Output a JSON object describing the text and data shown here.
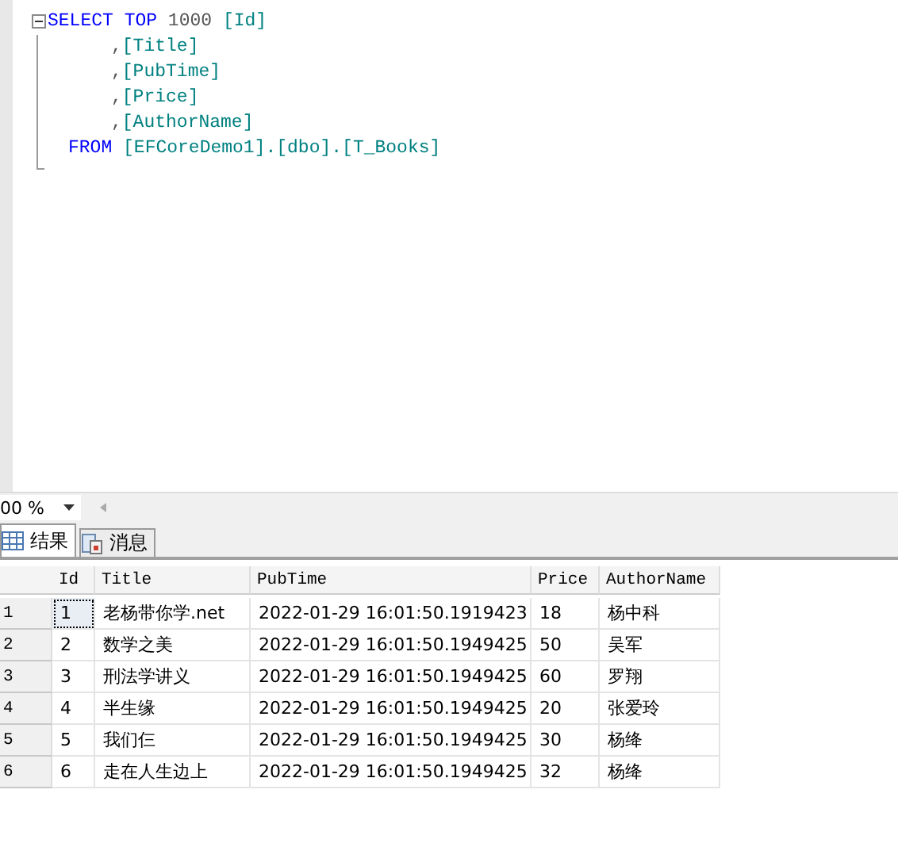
{
  "editor": {
    "lines": [
      {
        "kind": "select",
        "tokens": [
          {
            "kind": "keyword",
            "text": "SELECT "
          },
          {
            "kind": "keyword",
            "text": "TOP "
          },
          {
            "kind": "plain",
            "text": "1000 "
          },
          {
            "kind": "identifier",
            "text": "[Id]"
          }
        ]
      },
      {
        "kind": "column",
        "tokens": [
          {
            "kind": "plain",
            "text": ","
          },
          {
            "kind": "identifier",
            "text": "[Title]"
          }
        ]
      },
      {
        "kind": "column",
        "tokens": [
          {
            "kind": "plain",
            "text": ","
          },
          {
            "kind": "identifier",
            "text": "[PubTime]"
          }
        ]
      },
      {
        "kind": "column",
        "tokens": [
          {
            "kind": "plain",
            "text": ","
          },
          {
            "kind": "identifier",
            "text": "[Price]"
          }
        ]
      },
      {
        "kind": "column",
        "tokens": [
          {
            "kind": "plain",
            "text": ","
          },
          {
            "kind": "identifier",
            "text": "[AuthorName]"
          }
        ]
      },
      {
        "kind": "from",
        "tokens": [
          {
            "kind": "keyword",
            "text": "FROM "
          },
          {
            "kind": "identifier",
            "text": "[EFCoreDemo1].[dbo].[T_Books]"
          }
        ]
      }
    ]
  },
  "zoom": {
    "value": "00 %"
  },
  "tabs": [
    {
      "label": "结果",
      "selected": true
    },
    {
      "label": "消息",
      "selected": false
    }
  ],
  "table": {
    "columns": [
      "Id",
      "Title",
      "PubTime",
      "Price",
      "AuthorName"
    ],
    "rows": [
      {
        "number": "1",
        "selected": true,
        "cells": [
          "1",
          "老杨带你学.net",
          "2022-01-29 16:01:50.1919423",
          "18",
          "杨中科"
        ]
      },
      {
        "number": "2",
        "selected": false,
        "cells": [
          "2",
          "数学之美",
          "2022-01-29 16:01:50.1949425",
          "50",
          "吴军"
        ]
      },
      {
        "number": "3",
        "selected": false,
        "cells": [
          "3",
          "刑法学讲义",
          "2022-01-29 16:01:50.1949425",
          "60",
          "罗翔"
        ]
      },
      {
        "number": "4",
        "selected": false,
        "cells": [
          "4",
          "半生缘",
          "2022-01-29 16:01:50.1949425",
          "20",
          "张爱玲"
        ]
      },
      {
        "number": "5",
        "selected": false,
        "cells": [
          "5",
          "我们仨",
          "2022-01-29 16:01:50.1949425",
          "30",
          "杨绛"
        ]
      },
      {
        "number": "6",
        "selected": false,
        "cells": [
          "6",
          "走在人生边上",
          "2022-01-29 16:01:50.1949425",
          "32",
          "杨绛"
        ]
      }
    ]
  }
}
